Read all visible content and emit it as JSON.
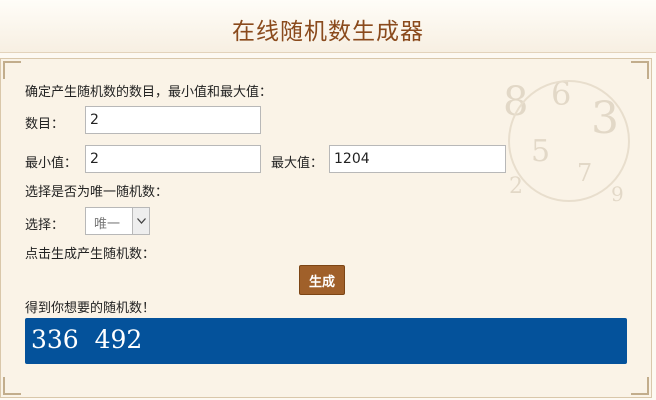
{
  "header": {
    "title": "在线随机数生成器"
  },
  "form": {
    "intro_text": "确定产生随机数的数目，最小值和最大值：",
    "count": {
      "label": "数目：",
      "value": "2"
    },
    "min": {
      "label": "最小值：",
      "value": "2"
    },
    "max": {
      "label": "最大值：",
      "value": "1204"
    },
    "unique_prompt": "选择是否为唯一随机数：",
    "unique_select": {
      "label": "选择：",
      "value": "唯一"
    },
    "generate_prompt": "点击生成产生随机数：",
    "generate_button": "生成",
    "result_prompt": "得到你想要的随机数！",
    "result_value": "336  492"
  },
  "colors": {
    "title": "#8a4a1c",
    "button": "#a0602a",
    "result_background": "#04529b",
    "panel_background": "#faf3e7"
  }
}
